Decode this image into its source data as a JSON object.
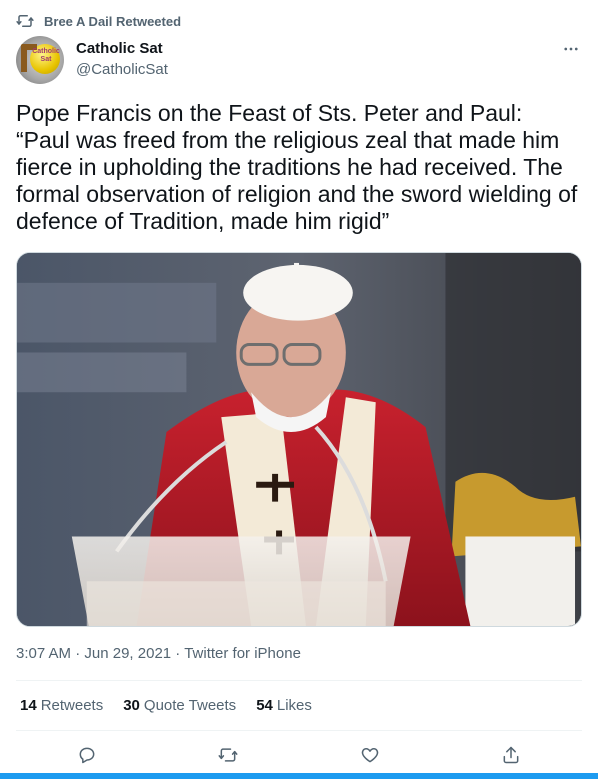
{
  "retweet": {
    "label": "Bree A Dail Retweeted",
    "icon": "retweet-icon"
  },
  "author": {
    "display_name": "Catholic Sat",
    "handle": "@CatholicSat",
    "avatar_text": "Catholic Sat",
    "more_icon": "more-icon"
  },
  "tweet": {
    "text": "Pope Francis on the Feast of Sts. Peter and Paul: “Paul was freed from the religious zeal that made him fierce in upholding the traditions he had received. The formal observation of religion and the sword wielding of defence of Tradition, made him rigid”"
  },
  "meta": {
    "time": "3:07 AM",
    "date": "Jun 29, 2021",
    "source": "Twitter for iPhone",
    "separator": " · "
  },
  "stats": {
    "retweets_count": "14",
    "retweets_label": "Retweets",
    "quotes_count": "30",
    "quotes_label": "Quote Tweets",
    "likes_count": "54",
    "likes_label": "Likes"
  },
  "actions": [
    {
      "icon": "reply-icon"
    },
    {
      "icon": "retweet-icon"
    },
    {
      "icon": "like-icon"
    },
    {
      "icon": "share-icon"
    }
  ],
  "colors": {
    "text_primary": "#0f1419",
    "text_secondary": "#536471",
    "accent": "#1d9bf0",
    "border": "#eff3f4"
  }
}
